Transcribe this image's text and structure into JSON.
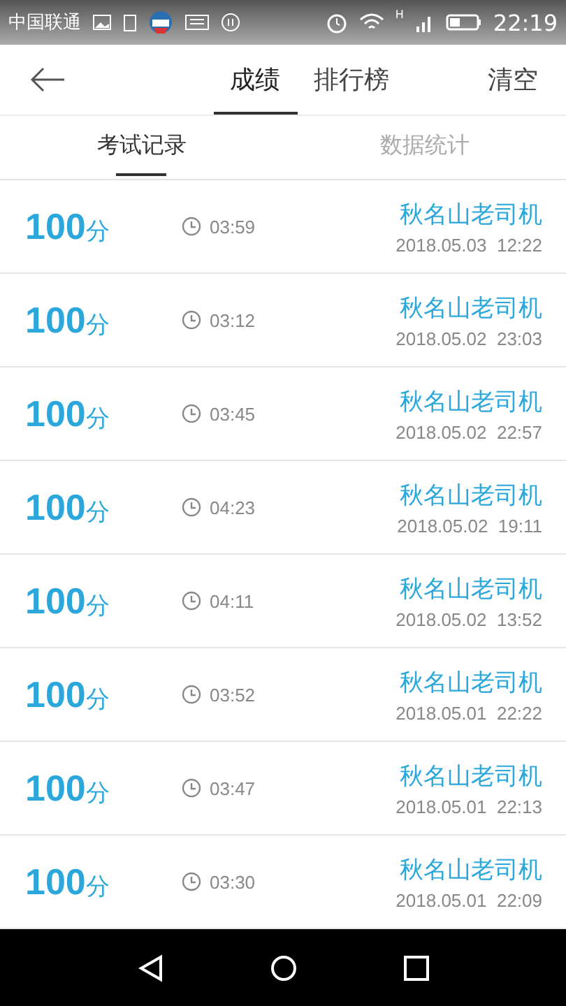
{
  "status_bar": {
    "carrier": "中国联通",
    "network_label": "H",
    "time": "22:19"
  },
  "header": {
    "tabs": [
      {
        "label": "成绩",
        "selected": true
      },
      {
        "label": "排行榜",
        "selected": false
      }
    ],
    "action": "清空"
  },
  "sub_tabs": [
    {
      "label": "考试记录",
      "selected": true
    },
    {
      "label": "数据统计",
      "selected": false
    }
  ],
  "records": [
    {
      "score": "100",
      "unit": "分",
      "duration": "03:59",
      "name": "秋名山老司机",
      "date": "2018.05.03",
      "time": "12:22"
    },
    {
      "score": "100",
      "unit": "分",
      "duration": "03:12",
      "name": "秋名山老司机",
      "date": "2018.05.02",
      "time": "23:03"
    },
    {
      "score": "100",
      "unit": "分",
      "duration": "03:45",
      "name": "秋名山老司机",
      "date": "2018.05.02",
      "time": "22:57"
    },
    {
      "score": "100",
      "unit": "分",
      "duration": "04:23",
      "name": "秋名山老司机",
      "date": "2018.05.02",
      "time": "19:11"
    },
    {
      "score": "100",
      "unit": "分",
      "duration": "04:11",
      "name": "秋名山老司机",
      "date": "2018.05.02",
      "time": "13:52"
    },
    {
      "score": "100",
      "unit": "分",
      "duration": "03:52",
      "name": "秋名山老司机",
      "date": "2018.05.01",
      "time": "22:22"
    },
    {
      "score": "100",
      "unit": "分",
      "duration": "03:47",
      "name": "秋名山老司机",
      "date": "2018.05.01",
      "time": "22:13"
    },
    {
      "score": "100",
      "unit": "分",
      "duration": "03:30",
      "name": "秋名山老司机",
      "date": "2018.05.01",
      "time": "22:09"
    }
  ]
}
